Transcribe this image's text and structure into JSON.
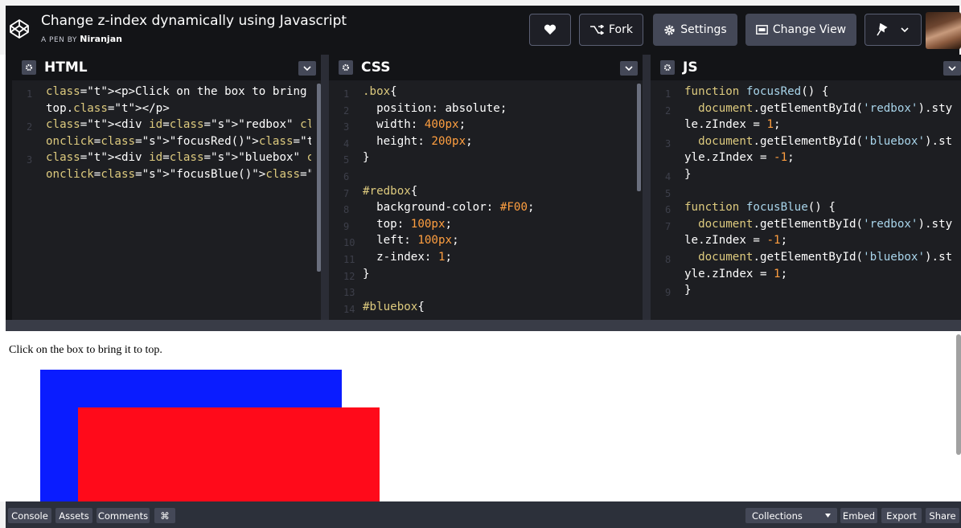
{
  "header": {
    "title": "Change z-index dynamically using Javascript",
    "byline_prefix": "A PEN BY",
    "author": "Niranjan",
    "fork_label": "Fork",
    "settings_label": "Settings",
    "change_view_label": "Change View"
  },
  "panes": {
    "html": {
      "title": "HTML"
    },
    "css": {
      "title": "CSS"
    },
    "js": {
      "title": "JS"
    }
  },
  "html_code": [
    {
      "n": "1",
      "text": "<p>Click on the box to bring it to"
    },
    {
      "n": "",
      "text": "top.</p>"
    },
    {
      "n": "2",
      "text": "<div id=\"redbox\" class=\"box\""
    },
    {
      "n": "",
      "text": "onclick=\"focusRed()\"></div>"
    },
    {
      "n": "3",
      "text": "<div id=\"bluebox\" class=\"box\""
    },
    {
      "n": "",
      "text": "onclick=\"focusBlue()\"></div>"
    }
  ],
  "css_code": [
    {
      "n": "1",
      "text": ".box{"
    },
    {
      "n": "2",
      "text": "  position: absolute;"
    },
    {
      "n": "3",
      "text": "  width: 400px;"
    },
    {
      "n": "4",
      "text": "  height: 200px;"
    },
    {
      "n": "5",
      "text": "}"
    },
    {
      "n": "6",
      "text": ""
    },
    {
      "n": "7",
      "text": "#redbox{"
    },
    {
      "n": "8",
      "text": "  background-color: #F00;"
    },
    {
      "n": "9",
      "text": "  top: 100px;"
    },
    {
      "n": "10",
      "text": "  left: 100px;"
    },
    {
      "n": "11",
      "text": "  z-index: 1;"
    },
    {
      "n": "12",
      "text": "}"
    },
    {
      "n": "13",
      "text": ""
    },
    {
      "n": "14",
      "text": "#bluebox{"
    }
  ],
  "js_code": [
    {
      "n": "1",
      "text": "function focusRed() {"
    },
    {
      "n": "2",
      "text": "  document.getElementById('redbox').sty"
    },
    {
      "n": "",
      "text": "le.zIndex = 1;"
    },
    {
      "n": "3",
      "text": "  document.getElementById('bluebox').st"
    },
    {
      "n": "",
      "text": "yle.zIndex = -1;"
    },
    {
      "n": "4",
      "text": "}"
    },
    {
      "n": "5",
      "text": ""
    },
    {
      "n": "6",
      "text": "function focusBlue() {"
    },
    {
      "n": "7",
      "text": "  document.getElementById('redbox').sty"
    },
    {
      "n": "",
      "text": "le.zIndex = -1;"
    },
    {
      "n": "8",
      "text": "  document.getElementById('bluebox').st"
    },
    {
      "n": "",
      "text": "yle.zIndex = 1;"
    },
    {
      "n": "9",
      "text": "}"
    }
  ],
  "preview": {
    "text": "Click on the box to bring it to top.",
    "red_color": "#F00",
    "blue_color": "#0a1cff"
  },
  "footer": {
    "console": "Console",
    "assets": "Assets",
    "comments": "Comments",
    "shortcut": "⌘",
    "collections": "Collections",
    "embed": "Embed",
    "export": "Export",
    "share": "Share"
  },
  "colors": {
    "header_bg": "#131417",
    "button_bg": "#444857",
    "editor_bg": "#1d1e22",
    "code_keyword": "#ddca7e",
    "code_string": "#a8d4ea",
    "code_number": "#ff9f40"
  }
}
